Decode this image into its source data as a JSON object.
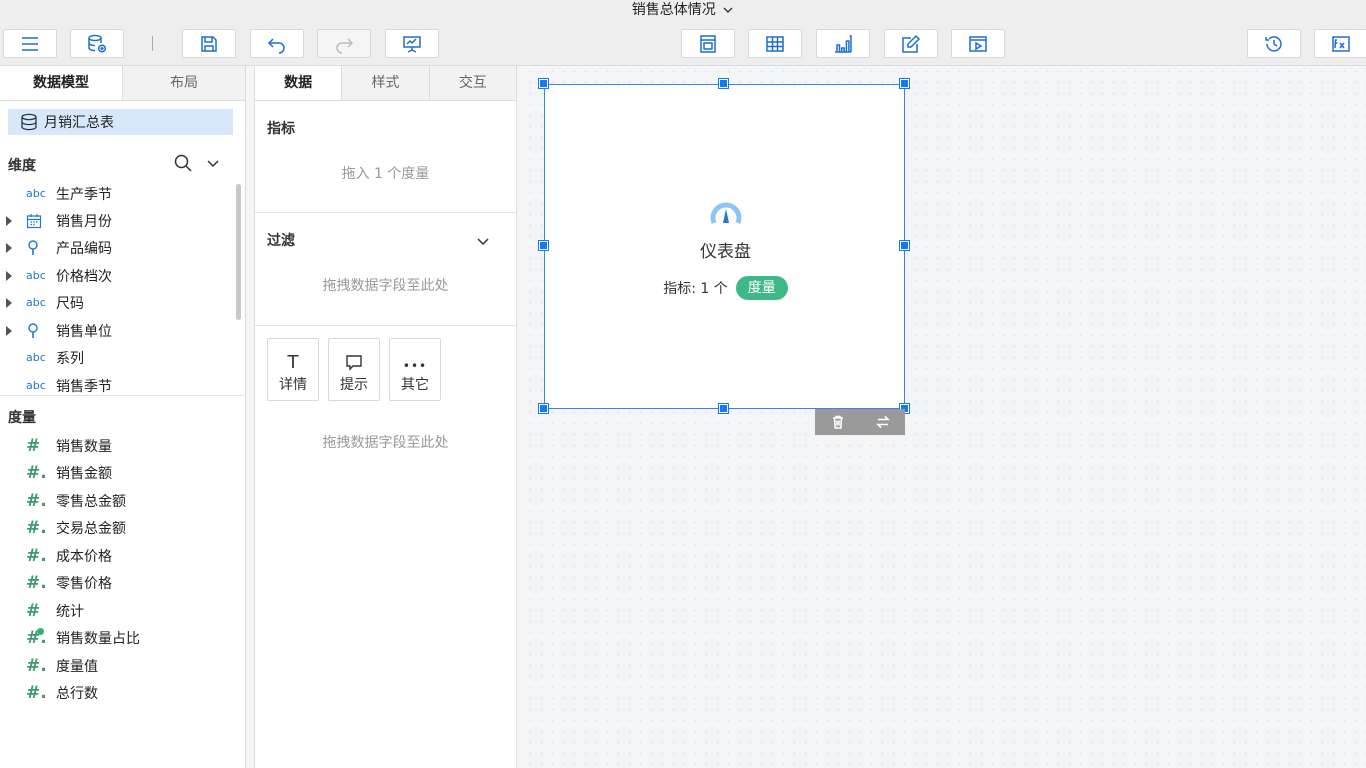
{
  "header": {
    "title": "销售总体情况"
  },
  "left_panel": {
    "tabs": [
      {
        "label": "数据模型",
        "active": true
      },
      {
        "label": "布局",
        "active": false
      }
    ],
    "dataset": "月销汇总表",
    "dimension_label": "维度",
    "dimensions": [
      {
        "label": "生产季节",
        "type": "abc",
        "expandable": false
      },
      {
        "label": "销售月份",
        "type": "calendar",
        "expandable": true
      },
      {
        "label": "产品编码",
        "type": "geo",
        "expandable": true
      },
      {
        "label": "价格档次",
        "type": "abc",
        "expandable": true
      },
      {
        "label": "尺码",
        "type": "abc",
        "expandable": true
      },
      {
        "label": "销售单位",
        "type": "geo",
        "expandable": true
      },
      {
        "label": "系列",
        "type": "abc",
        "expandable": false
      },
      {
        "label": "销售季节",
        "type": "abc",
        "expandable": false
      }
    ],
    "measure_label": "度量",
    "measures": [
      {
        "label": "销售数量"
      },
      {
        "label": "销售金额"
      },
      {
        "label": "零售总金额"
      },
      {
        "label": "交易总金额"
      },
      {
        "label": "成本价格"
      },
      {
        "label": "零售价格"
      },
      {
        "label": "统计"
      },
      {
        "label": "销售数量占比"
      },
      {
        "label": "度量值"
      },
      {
        "label": "总行数"
      }
    ],
    "abc_text": "abc"
  },
  "mid_panel": {
    "tabs": [
      {
        "label": "数据",
        "active": true
      },
      {
        "label": "样式",
        "active": false
      },
      {
        "label": "交互",
        "active": false
      }
    ],
    "indicator_label": "指标",
    "indicator_hint": "拖入 1 个度量",
    "filter_label": "过滤",
    "filter_hint": "拖拽数据字段至此处",
    "buttons": [
      {
        "label": "详情",
        "glyph": "T"
      },
      {
        "label": "提示",
        "glyph": "💬"
      },
      {
        "label": "其它",
        "glyph": "•••"
      }
    ],
    "bottom_hint": "拖拽数据字段至此处"
  },
  "widget": {
    "name": "仪表盘",
    "indicator_text": "指标: 1 个",
    "pill": "度量"
  },
  "colors": {
    "accent": "#1f6fd0",
    "measure_green": "#3eb886",
    "selection": "#3c82e6"
  }
}
